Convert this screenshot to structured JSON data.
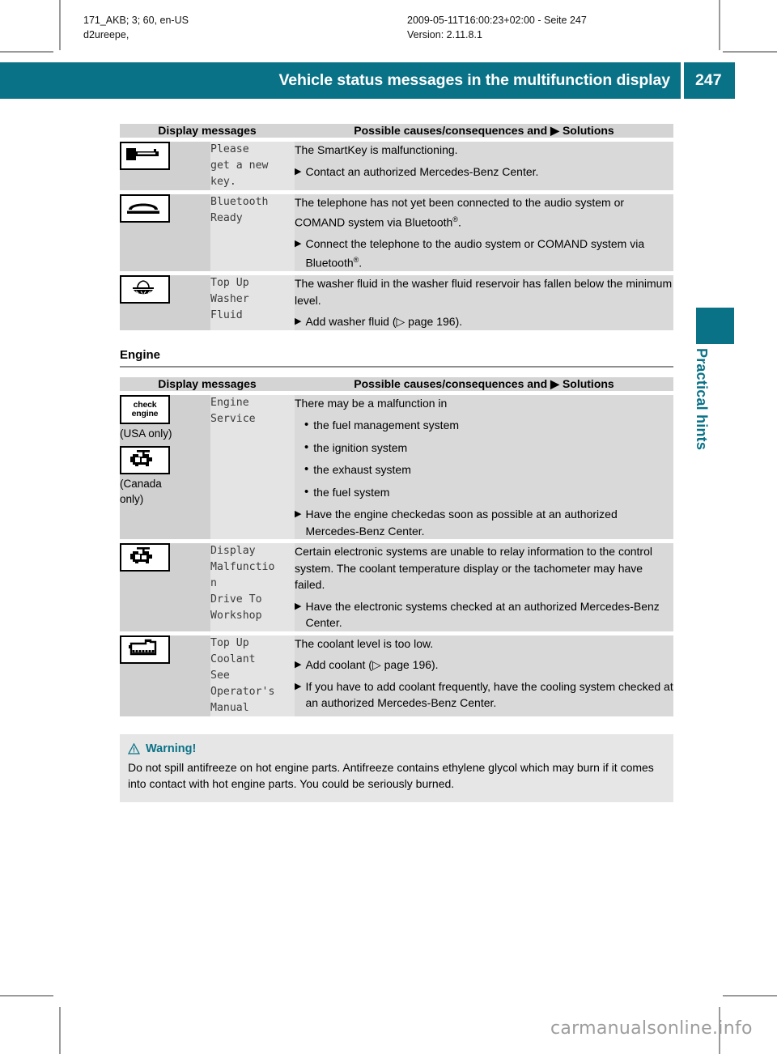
{
  "print_meta": {
    "left_line1": "171_AKB; 3; 60, en-US",
    "left_line2": "d2ureepe,",
    "right_line1": "2009-05-11T16:00:23+02:00 - Seite 247",
    "right_line2": "Version: 2.11.8.1"
  },
  "header": {
    "title": "Vehicle status messages in the multifunction display",
    "page_number": "247"
  },
  "side_tab": {
    "label": "Practical hints"
  },
  "colors": {
    "teal": "#0a7287",
    "icon_col_bg": "#d0d0d0",
    "msg_col_bg": "#e4e4e4",
    "desc_col_bg": "#d9d9d9",
    "table_header_bg": "#d4d4d4",
    "warning_bg": "#e6e6e6"
  },
  "table_headers": {
    "col1": "Display messages",
    "col2": "Possible causes/consequences and",
    "col2_suffix": "Solutions"
  },
  "table1": {
    "rows": [
      {
        "icon": "smartkey-icon",
        "message": "Please\nget a new\nkey.",
        "cause": "The SmartKey is malfunctioning.",
        "solutions": [
          "Contact an authorized Mercedes-Benz Center."
        ]
      },
      {
        "icon": "telephone-handset-icon",
        "message": "Bluetooth\nReady",
        "cause": "The telephone has not yet been connected to the audio system or COMAND system via Bluetooth®.",
        "solutions": [
          "Connect the telephone to the audio system or COMAND system via Bluetooth®."
        ]
      },
      {
        "icon": "washer-fluid-icon",
        "message": "Top Up\nWasher\nFluid",
        "cause": "The washer fluid in the washer fluid reservoir has fallen below the minimum level.",
        "solutions": [
          "Add washer fluid (▷ page 196)."
        ]
      }
    ]
  },
  "section": {
    "heading": "Engine"
  },
  "table2": {
    "rows": [
      {
        "icon": "check-engine-text-icon",
        "icon_text_line1": "check",
        "icon_text_line2": "engine",
        "icon_note1": "(USA only)",
        "icon2": "engine-block-icon",
        "icon_note2": "(Canada\nonly)",
        "message": "Engine\nService",
        "cause": "There may be a malfunction in",
        "bullets": [
          "the fuel management system",
          "the ignition system",
          "the exhaust system",
          "the fuel system"
        ],
        "solutions": [
          "Have the engine checkedas soon as possible at an authorized Mercedes-Benz Center."
        ]
      },
      {
        "icon": "engine-block-icon",
        "message": "Display\nMalfunctio\nn\nDrive To\nWorkshop",
        "cause": "Certain electronic systems are unable to relay information to the control system. The coolant temperature display or the tachometer may have failed.",
        "solutions": [
          "Have the electronic systems checked at an authorized Mercedes-Benz Center."
        ]
      },
      {
        "icon": "coolant-reservoir-icon",
        "message": "Top Up\nCoolant\nSee\nOperator's\n Manual",
        "cause": "The coolant level is too low.",
        "solutions": [
          "Add coolant (▷ page 196).",
          "If you have to add coolant frequently, have the cooling system checked at an authorized Mercedes-Benz Center."
        ]
      }
    ]
  },
  "warning": {
    "title": "Warning!",
    "body": "Do not spill antifreeze on hot engine parts. Antifreeze contains ethylene glycol which may burn if it comes into contact with hot engine parts. You could be seriously burned."
  },
  "watermark": {
    "text": "carmanualsonline.info"
  }
}
